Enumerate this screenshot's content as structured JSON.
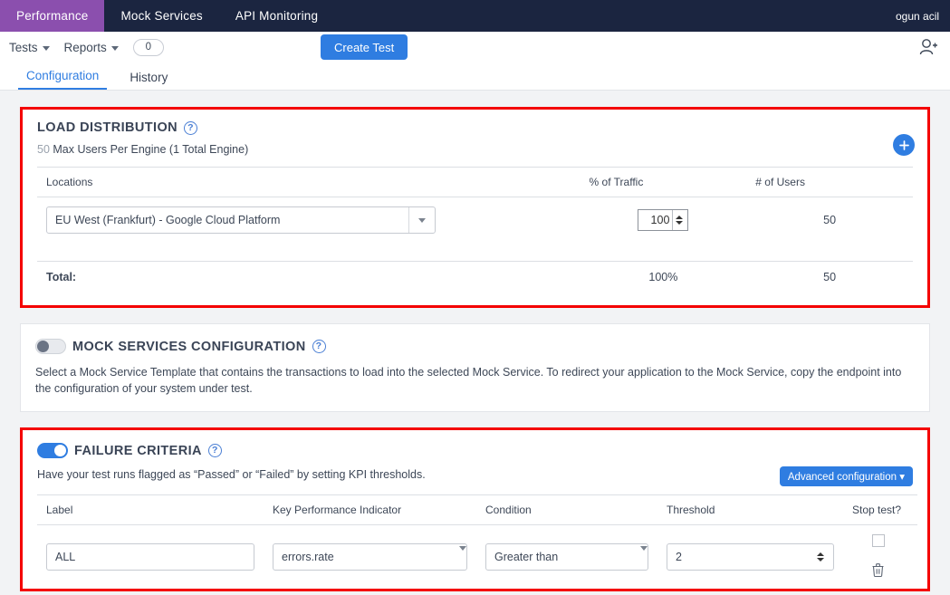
{
  "topnav": {
    "items": [
      {
        "label": "Performance",
        "active": true
      },
      {
        "label": "Mock Services",
        "active": false
      },
      {
        "label": "API Monitoring",
        "active": false
      }
    ],
    "user": "ogun acil"
  },
  "toolbar": {
    "tests_label": "Tests",
    "reports_label": "Reports",
    "reports_count": "0",
    "create_test_label": "Create Test",
    "add_user_icon": "person-add-icon"
  },
  "tabs": [
    {
      "label": "Configuration",
      "active": true
    },
    {
      "label": "History",
      "active": false
    }
  ],
  "load_distribution": {
    "title": "LOAD DISTRIBUTION",
    "help_icon": "help-icon",
    "max_users": "50",
    "max_users_text": "Max Users Per Engine (1 Total Engine)",
    "add_icon": "plus-icon",
    "columns": [
      "Locations",
      "% of Traffic",
      "# of Users"
    ],
    "rows": [
      {
        "location": "EU West (Frankfurt) - Google Cloud Platform",
        "traffic": "100",
        "users": "50"
      }
    ],
    "total_label": "Total:",
    "total_traffic": "100%",
    "total_users": "50"
  },
  "mock_services": {
    "title": "MOCK SERVICES CONFIGURATION",
    "enabled": false,
    "help_icon": "help-icon",
    "description": "Select a Mock Service Template that contains the transactions to load into the selected Mock Service. To redirect your application to the Mock Service, copy the endpoint into the configuration of your system under test."
  },
  "failure_criteria": {
    "title": "FAILURE CRITERIA",
    "enabled": true,
    "help_icon": "help-icon",
    "description": "Have your test runs flagged as “Passed” or “Failed” by setting KPI thresholds.",
    "advanced_label": "Advanced configuration",
    "columns": [
      "Label",
      "Key Performance Indicator",
      "Condition",
      "Threshold",
      "Stop test?"
    ],
    "rows": [
      {
        "label": "ALL",
        "kpi": "errors.rate",
        "condition": "Greater than",
        "threshold": "2",
        "stop_test": false,
        "delete_icon": "trash-icon"
      }
    ]
  },
  "colors": {
    "navbar": "#1b2540",
    "active_tab": "#8b4fae",
    "accent": "#2f7de1",
    "highlight": "#f40000"
  }
}
